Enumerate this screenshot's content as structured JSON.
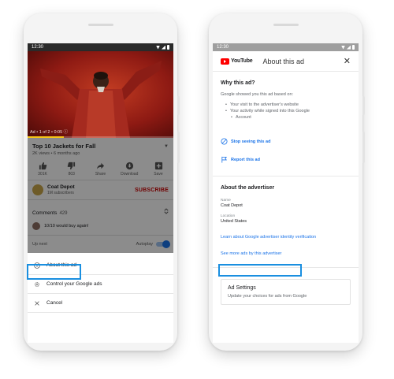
{
  "left_phone": {
    "status_time": "12:30",
    "video": {
      "ad_label": "Ad • 1 of 2 • 0:05 ⓘ",
      "progress": 0.25
    },
    "title": "Top 10 Jackets for Fall",
    "meta": "2K views • 6 months ago",
    "actions": [
      {
        "label": "301K"
      },
      {
        "label": "803"
      },
      {
        "label": "Share"
      },
      {
        "label": "Download"
      },
      {
        "label": "Save"
      }
    ],
    "channel": {
      "name": "Coat Depot",
      "subs": "1M subscribers",
      "subscribe_label": "SUBSCRIBE"
    },
    "comments": {
      "label": "Comments",
      "count": "429",
      "first_comment": "10/10 would buy again!"
    },
    "upnext_label": "Up next",
    "autoplay_label": "Autoplay",
    "menu": {
      "about_ad": "About this ad",
      "control_ads": "Control your Google ads",
      "cancel": "Cancel"
    }
  },
  "right_phone": {
    "status_time": "12:30",
    "brand": "YouTube",
    "header_title": "About this ad",
    "why_title": "Why this ad?",
    "why_text": "Google showed you this ad based on:",
    "bullets": [
      "Your visit to the advertiser's website",
      "Your activity while signed into this Google",
      "Account"
    ],
    "stop_seeing": "Stop seeing this ad",
    "report": "Report this ad",
    "advertiser_title": "About the advertiser",
    "name_label": "Name",
    "name_value": "Coat Depot",
    "location_label": "Location",
    "location_value": "United States",
    "learn_link": "Learn about Google advertiser identity verification",
    "see_more_link": "See more ads by this advertiser",
    "settings": {
      "title": "Ad Settings",
      "subtitle": "Update your choices for ads from Google"
    }
  },
  "colors": {
    "accent": "#1a73e8",
    "highlight": "#1a8fe0",
    "subscribe": "#cc0000",
    "youtube_red": "#ff0000"
  }
}
